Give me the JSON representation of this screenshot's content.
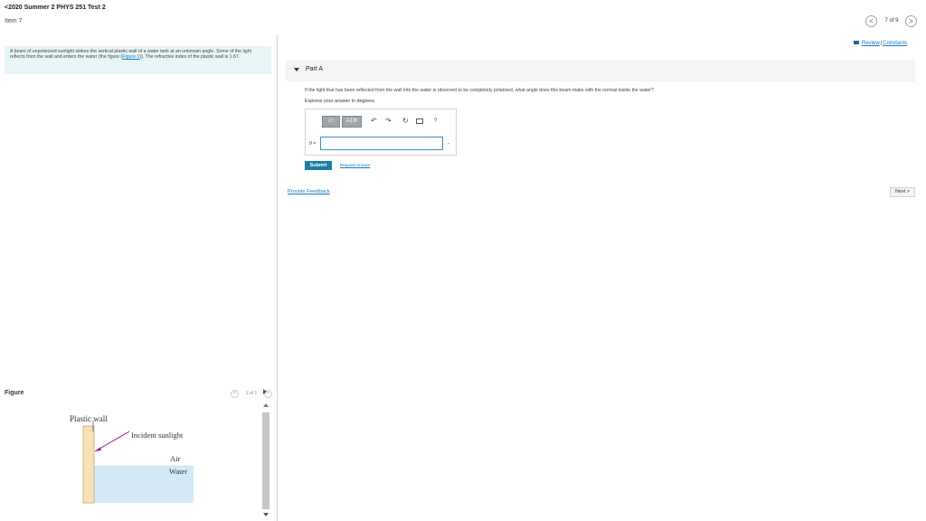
{
  "header": {
    "back_label": "<2020 Summer 2 PHYS 251 Test 2",
    "item_label": "Item 7",
    "pager": {
      "prev_glyph": "<",
      "text": "7 of 9",
      "next_glyph": ">"
    },
    "review_link": "Review",
    "separator": "|",
    "constants_link": "Constants"
  },
  "intro": {
    "text_before": "A beam of unpolarized sunlight strikes the vertical plastic wall of a water tank at an unknown angle. Some of the light reflects from the wall and enters the water (the figure (",
    "figure_link": "Figure 1",
    "text_after": ")). The refractive index of the plastic wall is 1.67."
  },
  "figure_panel": {
    "title": "Figure",
    "pager_text": "1 of 1",
    "prev_glyph": "<",
    "next_glyph": ">",
    "labels": {
      "plastic_wall": "Plastic wall",
      "incident_sunlight": "Incident sunlight",
      "air": "Air",
      "water": "Water"
    },
    "colors": {
      "wall": "#f7e2b7",
      "wall_edge": "#caa66a",
      "water": "#d3e9f8",
      "air": "#ffffff",
      "ray": "#9b1a80"
    }
  },
  "part": {
    "title": "Part A",
    "question": "If the light that has been reflected from the wall into the water is observed to be completely polarized, what angle does this beam make with the normal inside the water?",
    "instruction": "Express your answer in degrees.",
    "toolbar": {
      "templates_label": "√□",
      "greek_label": "AΣΦ",
      "undo_glyph": "↶",
      "redo_glyph": "↷",
      "reset_glyph": "↻",
      "help_glyph": "?"
    },
    "variable_label": "θ =",
    "answer_value": "",
    "unit_glyph": "▾",
    "submit_label": "Submit",
    "request_answer_label": "Request Answer"
  },
  "footer": {
    "provide_feedback_label": "Provide Feedback",
    "next_label": "Next >"
  }
}
